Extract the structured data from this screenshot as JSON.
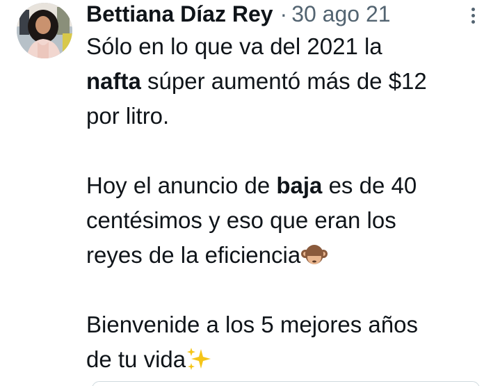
{
  "tweet": {
    "author": {
      "display_name": "Bettiana Díaz Rey",
      "avatar_icon": "profile-photo"
    },
    "separator": "·",
    "timestamp": "30 ago 21",
    "more_icon": "more-vertical-icon",
    "lines": {
      "l1": "Sólo en lo que va del 2021 la",
      "l2_bold": "nafta",
      "l2_rest": " súper aumentó más de $12",
      "l3": "por litro.",
      "l4_a": "Hoy el anuncio de ",
      "l4_bold": "baja",
      "l4_b": " es de 40",
      "l5": "centésimos y eso que eran los",
      "l6": "reyes de la eficiencia",
      "l6_emoji": "see-no-evil-monkey-icon",
      "l7": "Bienvenide a los 5 mejores años",
      "l8": "de tu vida",
      "l8_emoji": "sparkles-icon"
    },
    "colors": {
      "text": "#0f1419",
      "secondary": "#536471",
      "border": "#cfd9de"
    }
  }
}
